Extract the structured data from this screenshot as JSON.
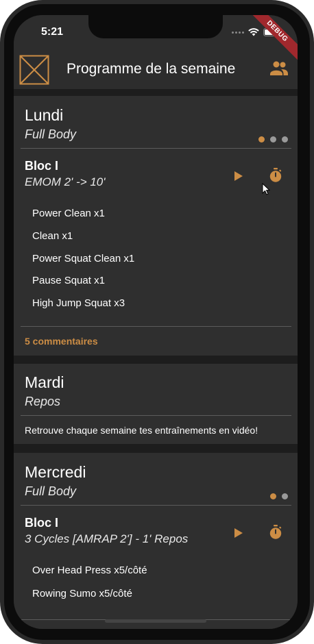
{
  "status": {
    "time": "5:21",
    "debug_label": "DEBUG"
  },
  "app_bar": {
    "title": "Programme de la semaine"
  },
  "colors": {
    "accent": "#cc8d45",
    "surface": "#2f2f2f",
    "background": "#1d1d1d",
    "dot_inactive": "#9a9a9a"
  },
  "days": [
    {
      "name": "Lundi",
      "subtitle": "Full Body",
      "pager_dots": 3,
      "pager_active": 0,
      "bloc": {
        "title": "Bloc I",
        "subtitle": "EMOM 2' -> 10'",
        "exercises": [
          "Power Clean x1",
          "Clean x1",
          "Power Squat Clean x1",
          "Pause Squat x1",
          "High Jump Squat x3"
        ]
      },
      "comments": "5 commentaires"
    },
    {
      "name": "Mardi",
      "subtitle": "Repos",
      "message": "Retrouve chaque semaine tes entraînements en vidéo!"
    },
    {
      "name": "Mercredi",
      "subtitle": "Full Body",
      "pager_dots": 2,
      "pager_active": 0,
      "bloc": {
        "title": "Bloc I",
        "subtitle": "3 Cycles [AMRAP 2'] - 1' Repos",
        "exercises": [
          "Over Head Press x5/côté",
          "Rowing Sumo x5/côté"
        ]
      }
    }
  ]
}
